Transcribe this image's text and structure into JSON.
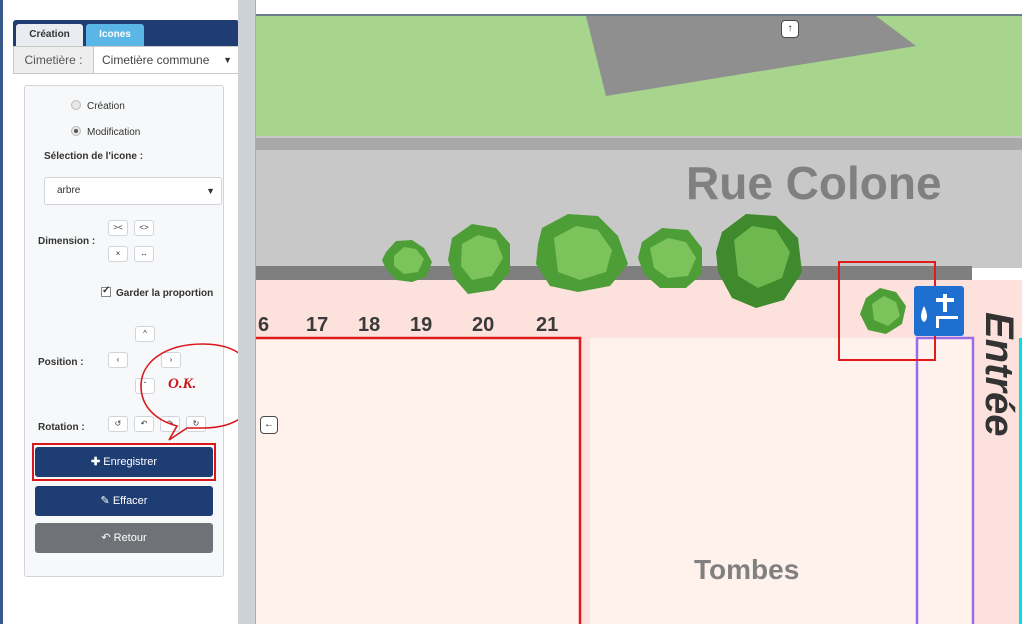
{
  "sidebar": {
    "tabs": [
      {
        "label": "Création"
      },
      {
        "label": "Icones"
      }
    ],
    "cimetiere_label": "Cimetière :",
    "cimetiere_value": "Cimetière commune",
    "mode_creation": "Création",
    "mode_modification": "Modification",
    "selection_label": "Sélection de l'icone :",
    "icon_select_value": "arbre",
    "dimension_label": "Dimension :",
    "keep_proportion_label": "Garder la proportion",
    "position_label": "Position :",
    "rotation_label": "Rotation :",
    "save_label": "Enregistrer",
    "clear_label": "Effacer",
    "back_label": "Retour",
    "annotation_text": "O.K."
  },
  "map": {
    "street": "Rue Colone",
    "plot_numbers": [
      "6",
      "17",
      "18",
      "19",
      "20",
      "21"
    ],
    "tombes_label": "Tombes",
    "entree_label": "Entrée"
  },
  "colors": {
    "navy": "#1e3d73",
    "tab_active": "#59b6e6",
    "grass": "#a8d58d",
    "road": "#c8c8c8",
    "sidewalk": "#fde1dc",
    "plot_border": "#e01b1b",
    "entrance_border": "#9a6ce8",
    "annotation_red": "#d9171d"
  },
  "icons": [
    "tree-icon",
    "water-tap-icon",
    "arrow-up-icon",
    "arrow-left-icon",
    "plus-icon",
    "brush-icon",
    "undo-icon"
  ]
}
